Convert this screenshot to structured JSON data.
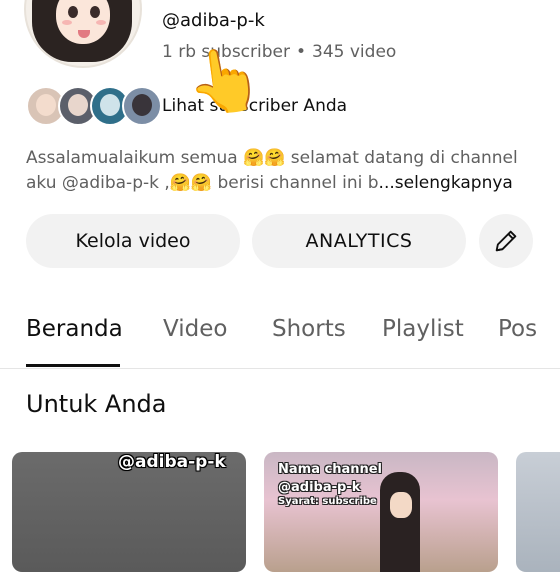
{
  "channel": {
    "handle": "@adiba-p-k",
    "subscriber_count": "1 rb subscriber",
    "video_count": "345 video",
    "separator": "•",
    "subscribers_link": "Lihat subscriber Anda",
    "description_line1": "Assalamualaikum  semua 🤗🤗 selamat datang di channel",
    "description_line2": "aku @adiba-p-k ,🤗🤗 berisi channel ini b",
    "description_more": "...selengkapnya"
  },
  "actions": {
    "manage_videos": "Kelola video",
    "analytics": "ANALYTICS",
    "edit_icon": "pencil-icon"
  },
  "tabs": [
    "Beranda",
    "Video",
    "Shorts",
    "Playlist",
    "Pos"
  ],
  "active_tab": "Beranda",
  "section": {
    "title": "Untuk Anda"
  },
  "thumbnails": {
    "t1_overlay": "@adiba-p-k",
    "t2_line1": "Nama channel",
    "t2_line2": "@adiba-p-k",
    "t2_line3": "Syarat: subscribe"
  },
  "overlay": {
    "pointer_emoji": "👆"
  },
  "colors": {
    "text_primary": "#0f0f0f",
    "text_secondary": "#606060",
    "button_bg": "#f2f2f2",
    "divider": "#e5e5e5"
  }
}
